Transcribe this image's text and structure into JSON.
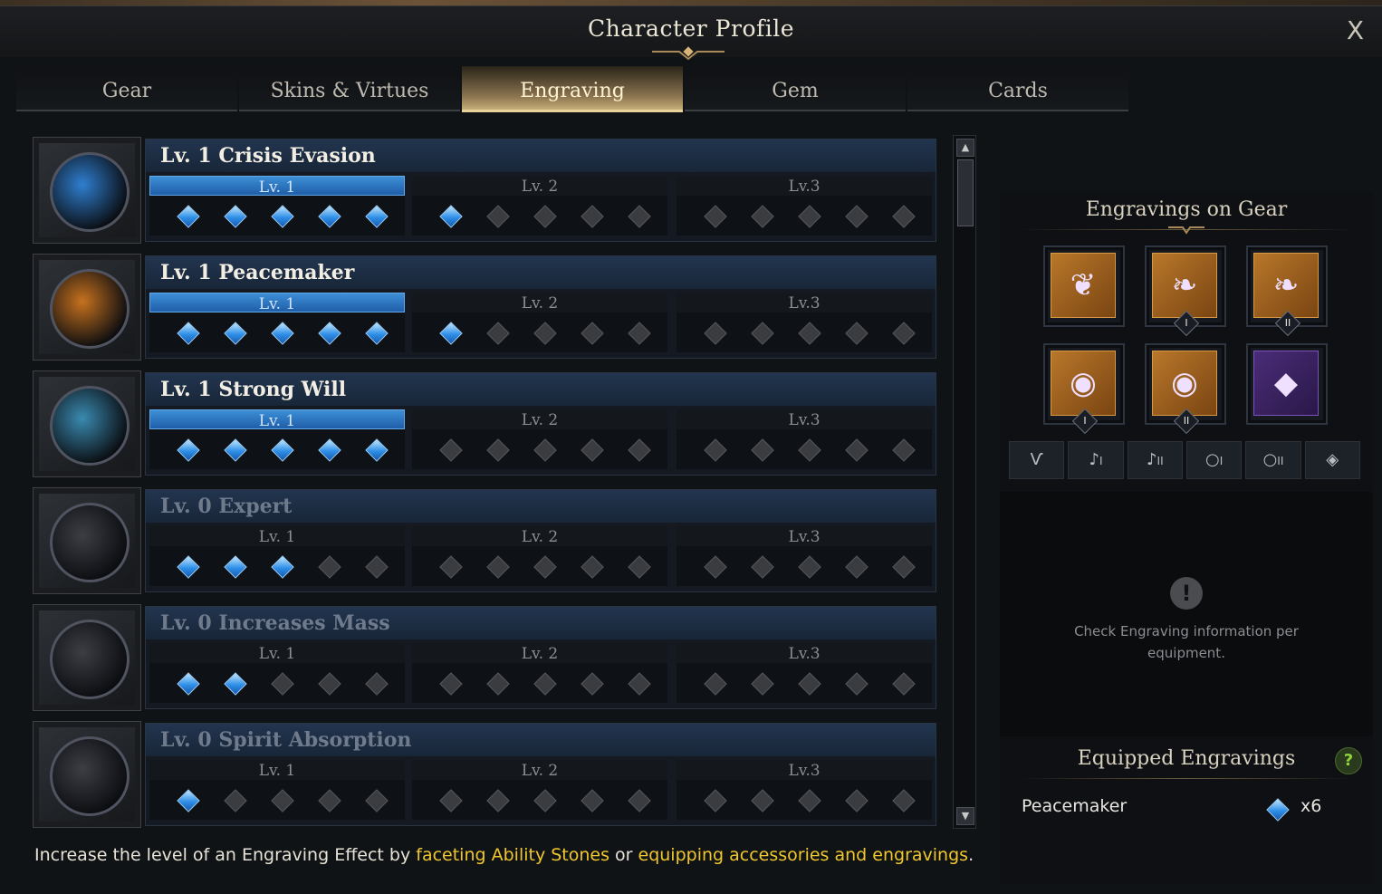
{
  "window": {
    "title": "Character Profile",
    "close_label": "X"
  },
  "tabs": [
    {
      "label": "Gear",
      "active": false
    },
    {
      "label": "Skins & Virtues",
      "active": false
    },
    {
      "label": "Engraving",
      "active": true
    },
    {
      "label": "Gem",
      "active": false
    },
    {
      "label": "Cards",
      "active": false
    }
  ],
  "engravings": [
    {
      "name": "Lv. 1 Crisis Evasion",
      "active": true,
      "levels": [
        "Lv. 1",
        "Lv. 2",
        "Lv.3"
      ],
      "filled_nodes": 6,
      "icon": "crisis-evasion-icon",
      "orb_color": "#2f7fd0"
    },
    {
      "name": "Lv. 1 Peacemaker",
      "active": true,
      "levels": [
        "Lv. 1",
        "Lv. 2",
        "Lv.3"
      ],
      "filled_nodes": 6,
      "icon": "peacemaker-icon",
      "orb_color": "#c7721e"
    },
    {
      "name": "Lv. 1 Strong Will",
      "active": true,
      "levels": [
        "Lv. 1",
        "Lv. 2",
        "Lv.3"
      ],
      "filled_nodes": 5,
      "icon": "strong-will-icon",
      "orb_color": "#3a8ab0"
    },
    {
      "name": "Lv. 0 Expert",
      "active": false,
      "levels": [
        "Lv. 1",
        "Lv. 2",
        "Lv.3"
      ],
      "filled_nodes": 3,
      "icon": "expert-icon",
      "orb_color": "#3c3e44"
    },
    {
      "name": "Lv. 0 Increases Mass",
      "active": false,
      "levels": [
        "Lv. 1",
        "Lv. 2",
        "Lv.3"
      ],
      "filled_nodes": 2,
      "icon": "increases-mass-icon",
      "orb_color": "#3c3e44"
    },
    {
      "name": "Lv. 0 Spirit Absorption",
      "active": false,
      "levels": [
        "Lv. 1",
        "Lv. 2",
        "Lv.3"
      ],
      "filled_nodes": 1,
      "icon": "spirit-absorption-icon",
      "orb_color": "#3c3e44"
    }
  ],
  "footer": {
    "prefix": "Increase the level of an Engraving Effect by ",
    "link1": "faceting Ability Stones",
    "middle": " or ",
    "link2": "equipping accessories and engravings",
    "suffix": "."
  },
  "side": {
    "gear_heading": "Engravings on Gear",
    "slots": [
      {
        "icon": "necklace-icon",
        "badge": ""
      },
      {
        "icon": "earring-icon",
        "badge": "I"
      },
      {
        "icon": "earring-icon",
        "badge": "II"
      },
      {
        "icon": "ring-icon",
        "badge": "I"
      },
      {
        "icon": "ring-icon",
        "badge": "II"
      },
      {
        "icon": "ability-stone-icon",
        "badge": ""
      }
    ],
    "filters": [
      {
        "icon": "necklace-filter-icon",
        "label": ""
      },
      {
        "icon": "earring-filter-icon",
        "label": "I"
      },
      {
        "icon": "earring-filter-icon",
        "label": "II"
      },
      {
        "icon": "ring-filter-icon",
        "label": "I"
      },
      {
        "icon": "ring-filter-icon",
        "label": "II"
      },
      {
        "icon": "stone-filter-icon",
        "label": ""
      }
    ],
    "info_text": "Check Engraving information per equipment.",
    "equipped_heading": "Equipped Engravings",
    "help_label": "?",
    "equipped": [
      {
        "name": "Peacemaker",
        "count": "x6"
      }
    ]
  },
  "colors": {
    "accent_gold": "#f0c72c",
    "node_blue": "#2f8fe8",
    "help_green": "#8ed438"
  }
}
